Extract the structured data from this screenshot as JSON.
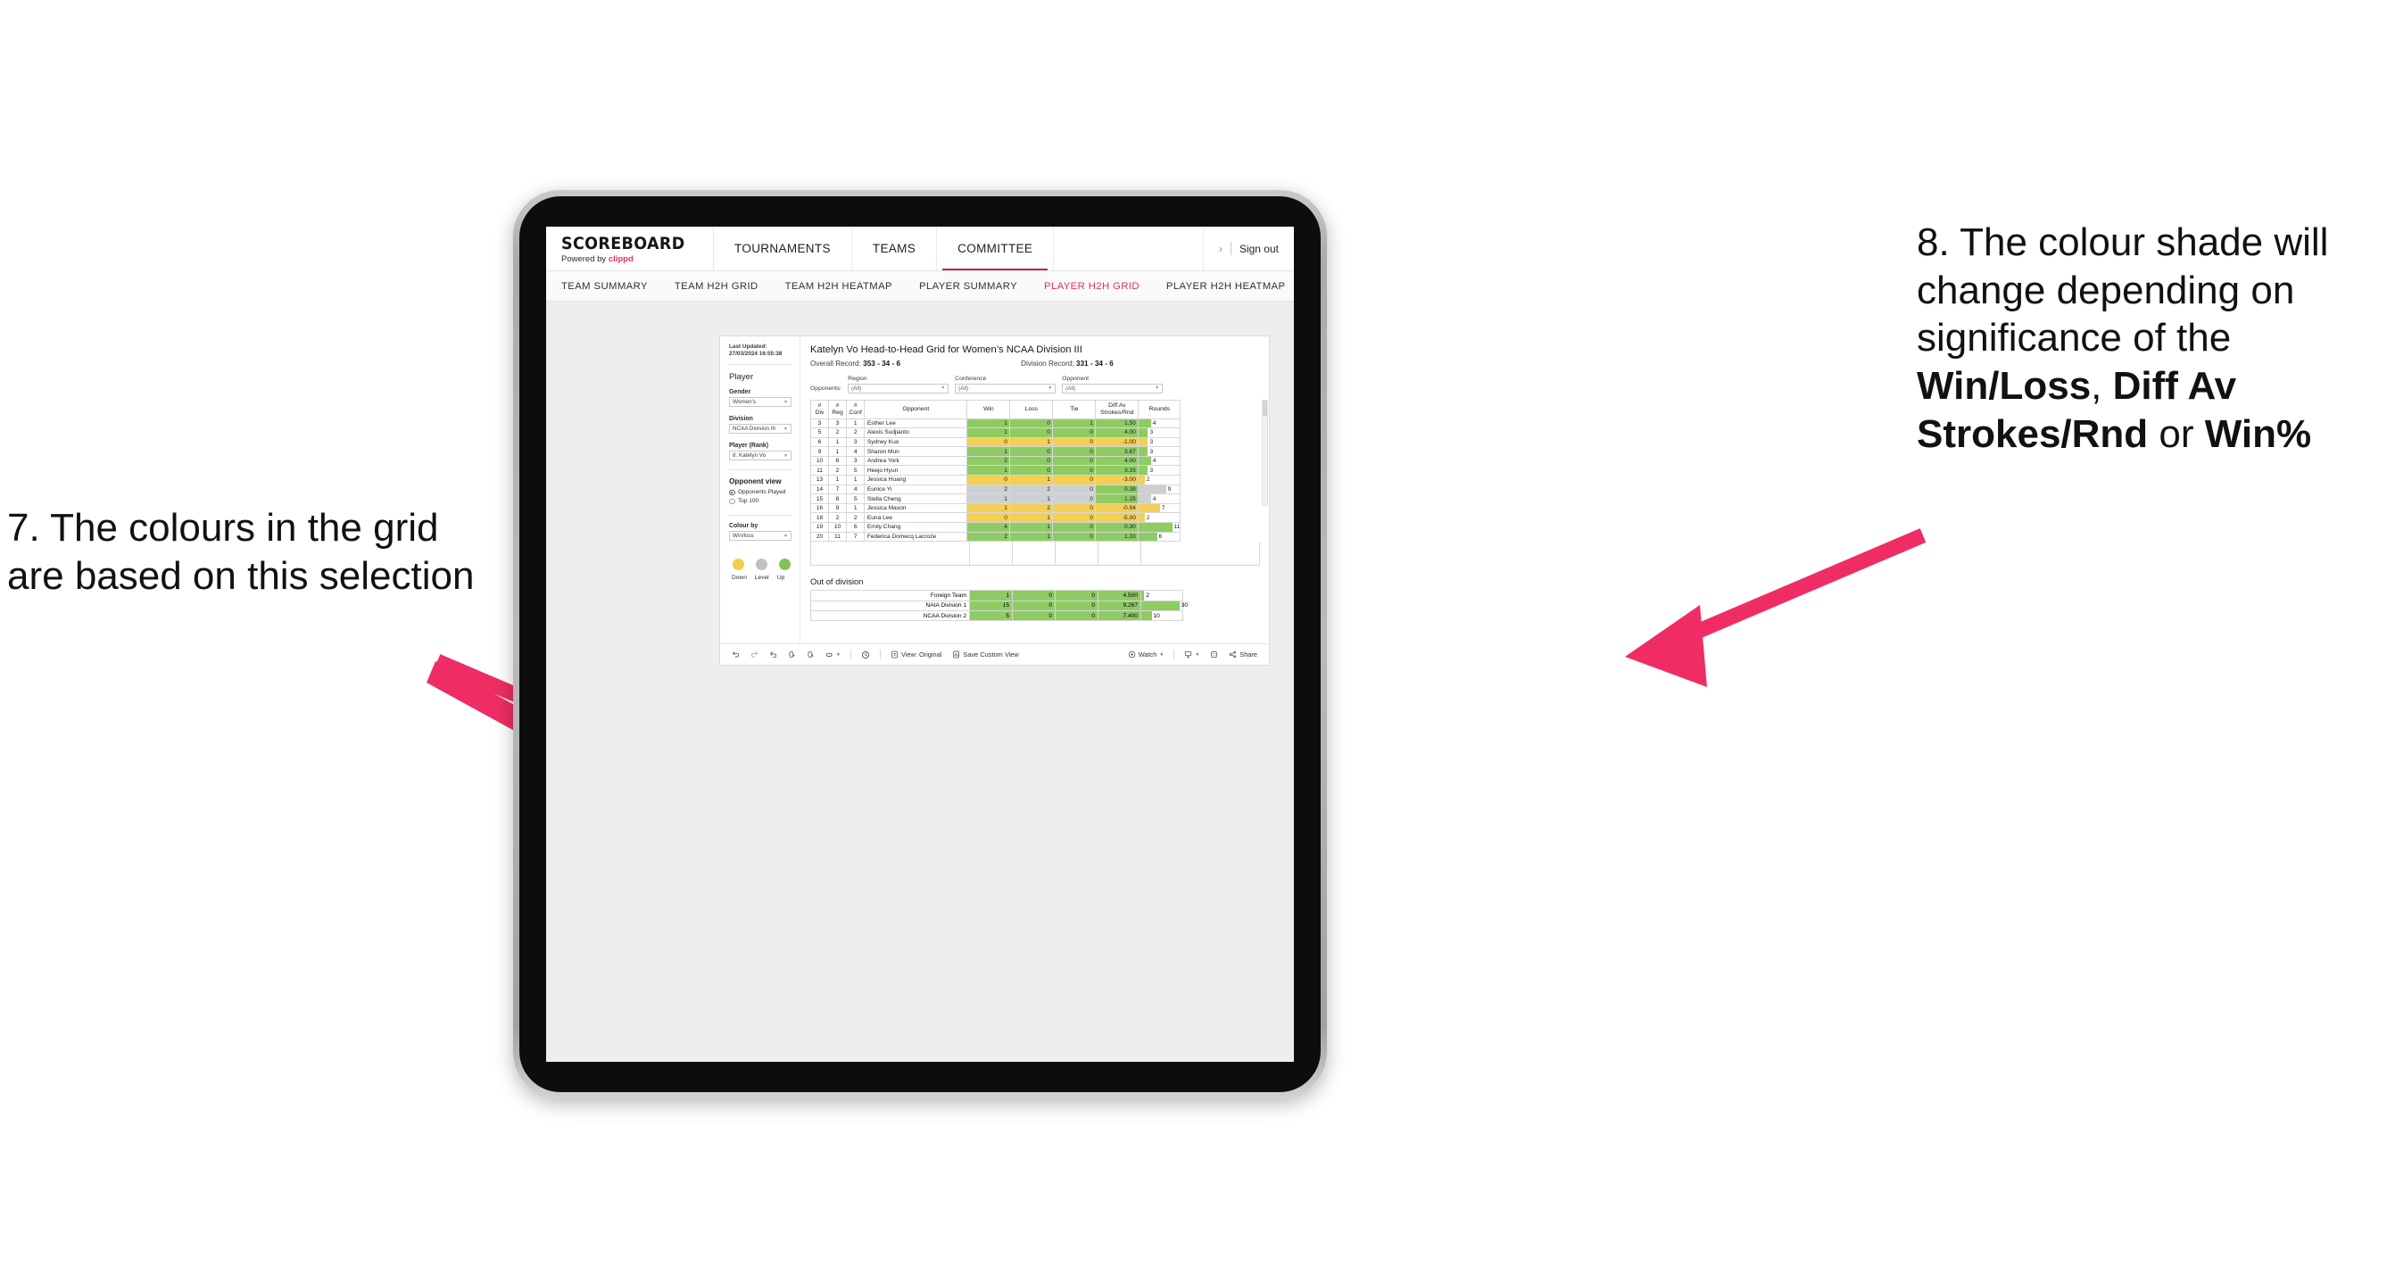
{
  "annotations": {
    "left": {
      "id": "7",
      "text": "7. The colours in the grid are based on this selection"
    },
    "right": {
      "id": "8",
      "line1": "8. The colour shade will change depending on significance of the ",
      "bold1": "Win/Loss",
      "mid1": ", ",
      "bold2": "Diff Av Strokes/Rnd",
      "mid2": " or ",
      "bold3": "Win%"
    },
    "arrow_color": "#ef2d64"
  },
  "app": {
    "brand": {
      "title": "SCOREBOARD",
      "powered_prefix": "Powered by ",
      "powered_brand": "clippd"
    },
    "topnav": [
      {
        "label": "TOURNAMENTS",
        "active": false
      },
      {
        "label": "TEAMS",
        "active": false
      },
      {
        "label": "COMMITTEE",
        "active": true
      }
    ],
    "account": {
      "chevron": "›",
      "signout": "Sign out"
    },
    "subnav": [
      {
        "label": "TEAM SUMMARY",
        "active": false
      },
      {
        "label": "TEAM H2H GRID",
        "active": false
      },
      {
        "label": "TEAM H2H HEATMAP",
        "active": false
      },
      {
        "label": "PLAYER SUMMARY",
        "active": false
      },
      {
        "label": "PLAYER H2H GRID",
        "active": true
      },
      {
        "label": "PLAYER H2H HEATMAP",
        "active": false
      }
    ],
    "accent_pink": "#e0325c"
  },
  "rail": {
    "last_updated": "Last Updated: 27/03/2024 16:55:38",
    "section_player": "Player",
    "gender_label": "Gender",
    "gender_value": "Women’s",
    "division_label": "Division",
    "division_value": "NCAA Division III",
    "player_label": "Player (Rank)",
    "player_value": "8. Katelyn Vo",
    "opponent_view_label": "Opponent view",
    "opponent_view_options": [
      {
        "label": "Opponents Played",
        "selected": true
      },
      {
        "label": "Top 100",
        "selected": false
      }
    ],
    "colour_by_label": "Colour by",
    "colour_by_value": "Win/loss",
    "legend": [
      {
        "label": "Down",
        "color": "#f2ce4b"
      },
      {
        "label": "Level",
        "color": "#bdc0c4"
      },
      {
        "label": "Up",
        "color": "#7fc455"
      }
    ]
  },
  "viz": {
    "title": "Katelyn Vo Head-to-Head Grid for Women’s NCAA Division III",
    "overall_record_label": "Overall Record: ",
    "overall_record_value": "353 -  34 - 6",
    "division_record_label": "Division Record: ",
    "division_record_value": "331 -  34 - 6",
    "opponents_label": "Opponents:",
    "opponent_filters": [
      {
        "label": "Region",
        "value": "(All)"
      },
      {
        "label": "Conference",
        "value": "(All)"
      },
      {
        "label": "Opponent",
        "value": "(All)"
      }
    ],
    "columns": [
      "# Div",
      "# Reg",
      "# Conf",
      "Opponent",
      "Win",
      "Loss",
      "Tie",
      "Diff Av Strokes/Rnd",
      "Rounds"
    ],
    "column_lines": [
      [
        "#",
        "Div"
      ],
      [
        "#",
        "Reg"
      ],
      [
        "#",
        "Conf"
      ],
      [
        "Opponent"
      ],
      [
        "Win"
      ],
      [
        "Loss"
      ],
      [
        "Tie"
      ],
      [
        "Diff Av",
        "Strokes/Rnd"
      ],
      [
        "Rounds"
      ]
    ],
    "rows": [
      {
        "div": "3",
        "reg": "3",
        "conf": "1",
        "opponent": "Esther Lee",
        "win": "1",
        "loss": "0",
        "tie": "1",
        "diff": "1.50",
        "rounds": "4",
        "shade": "up",
        "diff_shade": "up",
        "bar_pct": 29
      },
      {
        "div": "5",
        "reg": "2",
        "conf": "2",
        "opponent": "Alexis Sudjianto",
        "win": "1",
        "loss": "0",
        "tie": "0",
        "diff": "4.00",
        "rounds": "3",
        "shade": "up",
        "diff_shade": "up",
        "bar_pct": 22
      },
      {
        "div": "6",
        "reg": "1",
        "conf": "3",
        "opponent": "Sydney Kuo",
        "win": "0",
        "loss": "1",
        "tie": "0",
        "diff": "-1.00",
        "rounds": "3",
        "shade": "down",
        "diff_shade": "down",
        "bar_pct": 22
      },
      {
        "div": "9",
        "reg": "1",
        "conf": "4",
        "opponent": "Sharon Mun",
        "win": "1",
        "loss": "0",
        "tie": "0",
        "diff": "3.67",
        "rounds": "3",
        "shade": "up",
        "diff_shade": "up",
        "bar_pct": 22
      },
      {
        "div": "10",
        "reg": "6",
        "conf": "3",
        "opponent": "Andrea York",
        "win": "2",
        "loss": "0",
        "tie": "0",
        "diff": "4.00",
        "rounds": "4",
        "shade": "up",
        "diff_shade": "up",
        "bar_pct": 29
      },
      {
        "div": "11",
        "reg": "2",
        "conf": "5",
        "opponent": "Heejo Hyun",
        "win": "1",
        "loss": "0",
        "tie": "0",
        "diff": "3.33",
        "rounds": "3",
        "shade": "up",
        "diff_shade": "up",
        "bar_pct": 22
      },
      {
        "div": "13",
        "reg": "1",
        "conf": "1",
        "opponent": "Jessica Huang",
        "win": "0",
        "loss": "1",
        "tie": "0",
        "diff": "-3.00",
        "rounds": "2",
        "shade": "down",
        "diff_shade": "down",
        "bar_pct": 14
      },
      {
        "div": "14",
        "reg": "7",
        "conf": "4",
        "opponent": "Eunice Yi",
        "win": "2",
        "loss": "2",
        "tie": "0",
        "diff": "0.38",
        "rounds": "9",
        "shade": "level",
        "diff_shade": "up",
        "bar_pct": 66
      },
      {
        "div": "15",
        "reg": "8",
        "conf": "5",
        "opponent": "Stella Cheng",
        "win": "1",
        "loss": "1",
        "tie": "0",
        "diff": "1.25",
        "rounds": "4",
        "shade": "level",
        "diff_shade": "up",
        "bar_pct": 29
      },
      {
        "div": "16",
        "reg": "9",
        "conf": "1",
        "opponent": "Jessica Mason",
        "win": "1",
        "loss": "2",
        "tie": "0",
        "diff": "-0.94",
        "rounds": "7",
        "shade": "down",
        "diff_shade": "down",
        "bar_pct": 51
      },
      {
        "div": "18",
        "reg": "2",
        "conf": "2",
        "opponent": "Euna Lee",
        "win": "0",
        "loss": "1",
        "tie": "0",
        "diff": "-5.00",
        "rounds": "2",
        "shade": "down",
        "diff_shade": "down",
        "bar_pct": 14
      },
      {
        "div": "19",
        "reg": "10",
        "conf": "6",
        "opponent": "Emily Chang",
        "win": "4",
        "loss": "1",
        "tie": "0",
        "diff": "0.30",
        "rounds": "11",
        "shade": "up",
        "diff_shade": "up",
        "bar_pct": 81
      },
      {
        "div": "20",
        "reg": "11",
        "conf": "7",
        "opponent": "Federica Domecq Lacroze",
        "win": "2",
        "loss": "1",
        "tie": "0",
        "diff": "1.33",
        "rounds": "6",
        "shade": "up",
        "diff_shade": "up",
        "bar_pct": 44
      }
    ],
    "out_of_division_title": "Out of division",
    "out_of_division_rows": [
      {
        "name": "Foreign Team",
        "win": "1",
        "loss": "0",
        "tie": "0",
        "diff": "4.500",
        "rounds": "2",
        "shade": "up",
        "bar_pct": 7
      },
      {
        "name": "NAIA Division 1",
        "win": "15",
        "loss": "0",
        "tie": "0",
        "diff": "9.267",
        "rounds": "30",
        "shade": "up",
        "bar_pct": 93
      },
      {
        "name": "NCAA Division 2",
        "win": "5",
        "loss": "0",
        "tie": "0",
        "diff": "7.400",
        "rounds": "10",
        "shade": "up",
        "bar_pct": 25
      }
    ]
  },
  "toolbar": {
    "items": [
      {
        "name": "undo",
        "label": ""
      },
      {
        "name": "redo",
        "label": ""
      },
      {
        "name": "revert",
        "label": ""
      },
      {
        "name": "refresh",
        "label": ""
      },
      {
        "name": "pause",
        "label": ""
      },
      {
        "name": "view-mode",
        "label": ""
      },
      {
        "name": "history",
        "label": ""
      }
    ],
    "view_original": "View: Original",
    "save_custom_view": "Save Custom View",
    "watch": "Watch",
    "share": "Share"
  },
  "colors": {
    "up": "#8ecc63",
    "down": "#f3cf54",
    "level": "#cdd0d3",
    "accent": "#e0325c",
    "arrow": "#ef2d64"
  }
}
